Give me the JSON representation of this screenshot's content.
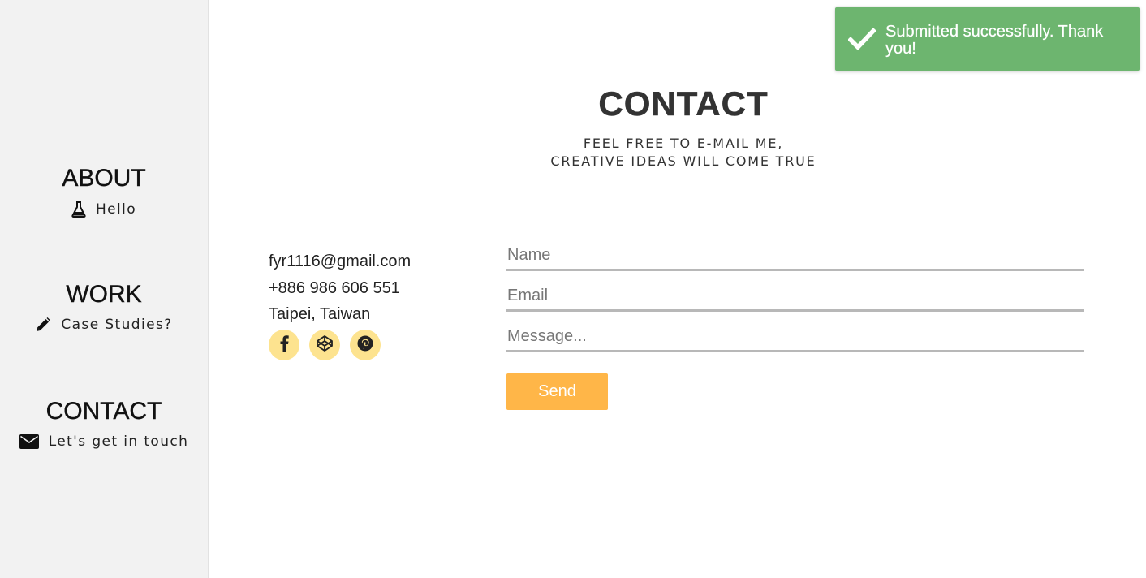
{
  "sidebar": {
    "sections": [
      {
        "heading": "ABOUT",
        "link": "Hello",
        "icon": "flask-icon"
      },
      {
        "heading": "WORK",
        "link": "Case Studies?",
        "icon": "pencil-icon"
      },
      {
        "heading": "CONTACT",
        "link": "Let's get in touch",
        "icon": "envelope-icon"
      }
    ]
  },
  "main": {
    "title": "CONTACT",
    "subtitle_line1": "FEEL FREE TO E-MAIL ME,",
    "subtitle_line2": "CREATIVE IDEAS WILL COME TRUE"
  },
  "contact_info": {
    "email": "fyr1116@gmail.com",
    "phone": "+886 986 606 551",
    "location": "Taipei, Taiwan",
    "socials": [
      "facebook-icon",
      "codepen-icon",
      "pinterest-icon"
    ]
  },
  "form": {
    "name_placeholder": "Name",
    "email_placeholder": "Email",
    "message_placeholder": "Message...",
    "send_label": "Send"
  },
  "toast": {
    "message": "Submitted successfully. Thank you!",
    "icon": "checkmark-icon"
  },
  "colors": {
    "sidebar_bg": "#f2f2f2",
    "social_bg": "#fde38f",
    "send_button": "#ffb648",
    "toast_bg": "#6db56f",
    "field_underline": "#b8b8b8"
  }
}
